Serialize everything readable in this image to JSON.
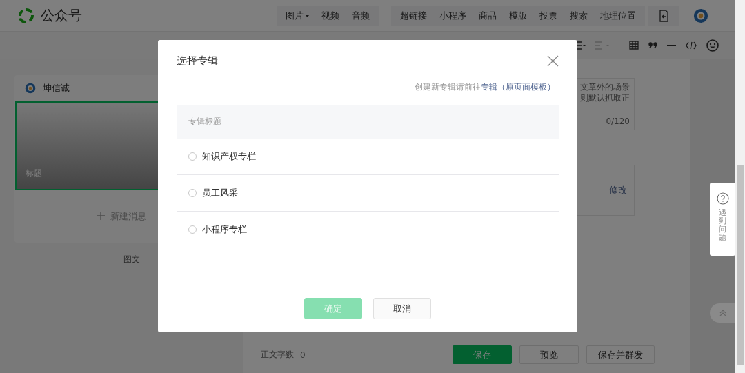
{
  "header": {
    "brand": "公众号",
    "toolbar_groups": [
      [
        {
          "label": "图片",
          "dropdown": true
        },
        {
          "label": "视频",
          "dropdown": false
        },
        {
          "label": "音频",
          "dropdown": false
        }
      ],
      [
        {
          "label": "超链接",
          "dropdown": false
        },
        {
          "label": "小程序",
          "dropdown": false
        },
        {
          "label": "商品",
          "dropdown": false
        },
        {
          "label": "模版",
          "dropdown": false
        },
        {
          "label": "投票",
          "dropdown": false
        },
        {
          "label": "搜索",
          "dropdown": false
        },
        {
          "label": "地理位置",
          "dropdown": false
        }
      ]
    ]
  },
  "left_panel": {
    "account": "坤信诚",
    "cover_title": "标题",
    "new_message": "新建消息",
    "library_link": "图文"
  },
  "editor": {
    "summary_lines": [
      "文章外的场景",
      "则默认抓取正"
    ],
    "summary_count": "0/120",
    "edit_link": "修改",
    "word_count_label": "正文字数",
    "word_count": "0",
    "buttons": [
      {
        "label": "保存",
        "kind": "primary"
      },
      {
        "label": "预览",
        "kind": "default"
      },
      {
        "label": "保存并群发",
        "kind": "default"
      }
    ]
  },
  "help": {
    "label": "遇到问题"
  },
  "dialog": {
    "title": "选择专辑",
    "hint": "创建新专辑请前往",
    "hint_link": "专辑（原页面模板）",
    "column": "专辑标题",
    "albums": [
      {
        "name": "知识产权专栏",
        "selected": false
      },
      {
        "name": "员工风采",
        "selected": false
      },
      {
        "name": "小程序专栏",
        "selected": false
      }
    ],
    "confirm": {
      "label": "确定",
      "disabled": true
    },
    "cancel": "取消"
  }
}
